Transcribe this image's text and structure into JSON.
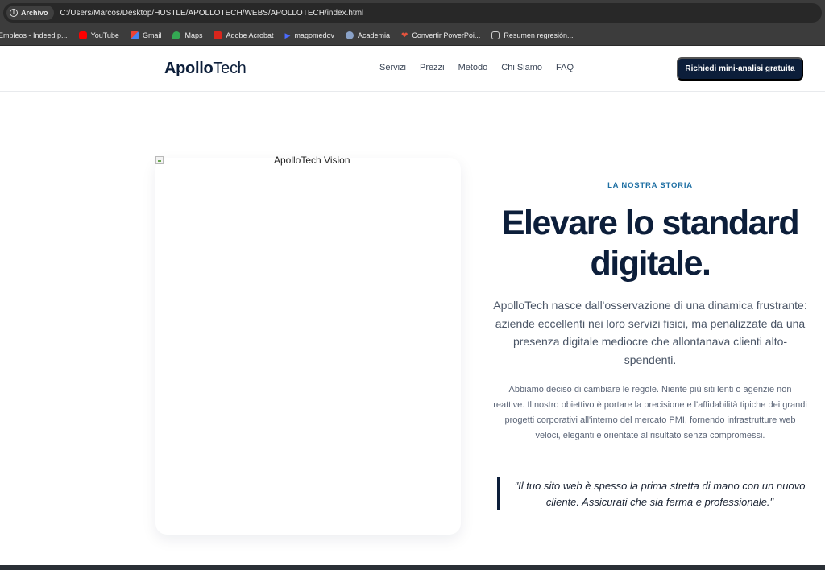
{
  "browser": {
    "site_chip": "Archivo",
    "url": "C:/Users/Marcos/Desktop/HUSTLE/APOLLOTECH/WEBS/APOLLOTECH/index.html",
    "bookmarks": [
      {
        "label": "Empleos - Indeed p...",
        "icon": "indeed-icon",
        "color": "#3c3c3c"
      },
      {
        "label": "YouTube",
        "icon": "youtube-icon",
        "color": "#ff0000"
      },
      {
        "label": "Gmail",
        "icon": "gmail-icon",
        "color": "#ea4335"
      },
      {
        "label": "Maps",
        "icon": "maps-icon",
        "color": "#34a853"
      },
      {
        "label": "Adobe Acrobat",
        "icon": "acrobat-icon",
        "color": "#d9261c"
      },
      {
        "label": "magomedov",
        "icon": "play-icon",
        "color": "#4b6bff"
      },
      {
        "label": "Academia",
        "icon": "academia-icon",
        "color": "#8aa2c8"
      },
      {
        "label": "Convertir PowerPoi...",
        "icon": "heart-icon",
        "color": "#e5533d"
      },
      {
        "label": "Resumen regresión...",
        "icon": "openai-icon",
        "color": "#d0d0d0"
      }
    ]
  },
  "nav": {
    "logo_bold": "Apollo",
    "logo_light": "Tech",
    "links": [
      "Servizi",
      "Prezzi",
      "Metodo",
      "Chi Siamo",
      "FAQ"
    ],
    "cta": "Richiedi mini-analisi gratuita"
  },
  "story": {
    "image_alt": "ApolloTech Vision",
    "eyebrow": "LA NOSTRA STORIA",
    "headline": "Elevare lo standard digitale.",
    "lead": "ApolloTech nasce dall'osservazione di una dinamica frustrante: aziende eccellenti nei loro servizi fisici, ma penalizzate da una presenza digitale mediocre che allontanava clienti alto-spendenti.",
    "body": "Abbiamo deciso di cambiare le regole. Niente più siti lenti o agenzie non reattive. Il nostro obiettivo è portare la precisione e l'affidabilità tipiche dei grandi progetti corporativi all'interno del mercato PMI, fornendo infrastrutture web veloci, eleganti e orientate al risultato senza compromessi.",
    "quote": "\"Il tuo sito web è spesso la prima stretta di mano con un nuovo cliente. Assicurati che sia ferma e professionale.\""
  },
  "colors": {
    "brand_navy": "#0c1e3a",
    "accent_blue": "#1e6fa3"
  }
}
